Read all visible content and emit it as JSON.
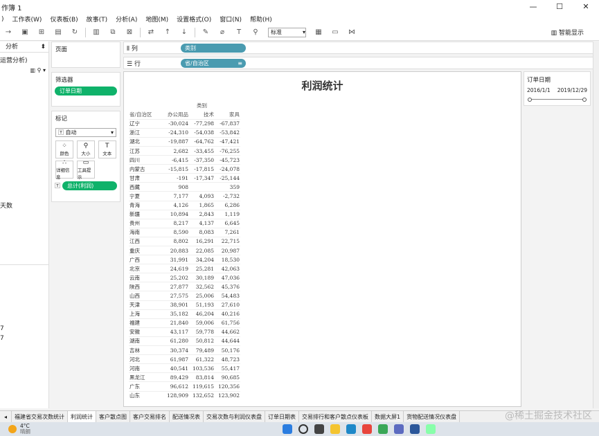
{
  "window": {
    "title": "作簿 1",
    "min": "—",
    "max": "☐",
    "close": "✕"
  },
  "menu": [
    "工作表(W)",
    "仪表板(B)",
    "故事(T)",
    "分析(A)",
    "地图(M)",
    "设置格式(O)",
    "窗口(N)",
    "帮助(H)"
  ],
  "toolbar": {
    "mark_type": "标准",
    "smart": "智能显示"
  },
  "left": {
    "header": "分析",
    "sub": "运营分析)",
    "label_a": "天数",
    "num_1": "7",
    "num_2": "7"
  },
  "pages_label": "页面",
  "filters": {
    "label": "筛选器",
    "pill": "订单日期"
  },
  "marks": {
    "label": "标记",
    "type": "自动",
    "buttons": [
      "颜色",
      "大小",
      "文本",
      "详细信息",
      "工具提示"
    ],
    "pill": "总计(利润)"
  },
  "shelves": {
    "columns_label": "列",
    "columns_pill": "类别",
    "rows_label": "行",
    "rows_pill": "省/自治区"
  },
  "sheet": {
    "title": "利润统计"
  },
  "chart_data": {
    "type": "table",
    "column_header": "类别",
    "row_header": "省/自治区",
    "columns": [
      "办公用品",
      "技术",
      "家具"
    ],
    "rows": [
      [
        "辽宁",
        "-30,024",
        "-77,298",
        "-67,837"
      ],
      [
        "浙江",
        "-24,310",
        "-54,038",
        "-53,842"
      ],
      [
        "湖北",
        "-19,887",
        "-64,762",
        "-47,421"
      ],
      [
        "江苏",
        "2,682",
        "-33,455",
        "-76,255"
      ],
      [
        "四川",
        "-6,415",
        "-37,350",
        "-45,723"
      ],
      [
        "内蒙古",
        "-15,815",
        "-17,815",
        "-24,078"
      ],
      [
        "甘肃",
        "-191",
        "-17,347",
        "-25,144"
      ],
      [
        "西藏",
        "908",
        "",
        "359"
      ],
      [
        "宁夏",
        "7,177",
        "4,093",
        "-2,732"
      ],
      [
        "青海",
        "4,126",
        "1,865",
        "6,286"
      ],
      [
        "新疆",
        "10,894",
        "2,843",
        "1,119"
      ],
      [
        "贵州",
        "8,217",
        "4,137",
        "6,645"
      ],
      [
        "海南",
        "8,590",
        "8,083",
        "7,261"
      ],
      [
        "江西",
        "8,802",
        "16,291",
        "22,715"
      ],
      [
        "重庆",
        "20,883",
        "22,085",
        "20,987"
      ],
      [
        "广西",
        "31,991",
        "34,204",
        "18,530"
      ],
      [
        "北京",
        "24,619",
        "25,281",
        "42,063"
      ],
      [
        "云南",
        "25,202",
        "30,189",
        "47,036"
      ],
      [
        "陕西",
        "27,877",
        "32,562",
        "45,376"
      ],
      [
        "山西",
        "27,575",
        "25,006",
        "54,483"
      ],
      [
        "天津",
        "38,901",
        "51,193",
        "27,610"
      ],
      [
        "上海",
        "35,182",
        "46,204",
        "40,216"
      ],
      [
        "福建",
        "21,840",
        "59,006",
        "61,756"
      ],
      [
        "安徽",
        "43,117",
        "59,778",
        "44,662"
      ],
      [
        "湖南",
        "61,280",
        "50,812",
        "44,644"
      ],
      [
        "吉林",
        "30,374",
        "79,489",
        "50,176"
      ],
      [
        "河北",
        "61,987",
        "61,322",
        "48,723"
      ],
      [
        "河南",
        "40,541",
        "103,536",
        "55,417"
      ],
      [
        "黑龙江",
        "89,429",
        "83,814",
        "90,685"
      ],
      [
        "广东",
        "96,612",
        "119,615",
        "120,356"
      ],
      [
        "山东",
        "128,909",
        "132,652",
        "123,902"
      ]
    ]
  },
  "date_filter": {
    "label": "订单日期",
    "start": "2016/1/1",
    "end": "2019/12/29"
  },
  "tabs": [
    "福建省交易次数统计",
    "利润统计",
    "客户散点图",
    "客户交易排名",
    "配送情况表",
    "交易次数与利润仪表盘",
    "订单日期表",
    "交易排行和客户散点仪表板",
    "数据大屏1",
    "货物配送情况仪表盘"
  ],
  "active_tab": 1,
  "taskbar": {
    "temp": "4°C",
    "weather": "晴朗"
  },
  "watermark": "@稀土掘金技术社区"
}
